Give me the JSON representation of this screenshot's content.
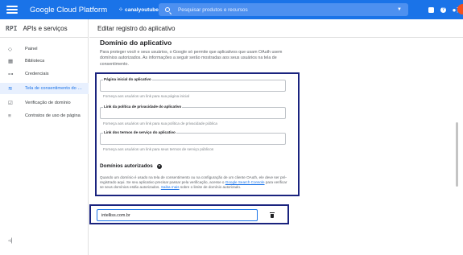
{
  "topbar": {
    "brand": "Google Cloud Platform",
    "project": "canalyoutube",
    "search_placeholder": "Pesquisar produtos e recursos",
    "accent": "#1a73e8"
  },
  "sidebar": {
    "api_badge": "RPI",
    "title": "APIs e serviços",
    "items": [
      {
        "label": "Painel",
        "icon": "dashboard-icon",
        "glyph": "◇"
      },
      {
        "label": "Biblioteca",
        "icon": "library-icon",
        "glyph": "▦"
      },
      {
        "label": "Credenciais",
        "icon": "key-icon",
        "glyph": "⊶"
      },
      {
        "label": "Tela de consentimento do O...",
        "icon": "consent-icon",
        "glyph": "≋"
      },
      {
        "label": "Verificação de domínio",
        "icon": "domain-check-icon",
        "glyph": "☑"
      },
      {
        "label": "Contratos de uso de página",
        "icon": "settings-list-icon",
        "glyph": "≡"
      }
    ],
    "collapse_glyph": "◃|"
  },
  "header": {
    "title": "Editar registro do aplicativo"
  },
  "app_domain": {
    "heading": "Domínio do aplicativo",
    "description": "Para proteger você e seus usuários, o Google só permite que aplicativos que usam OAuth usem domínios autorizados. As informações a seguir serão mostradas aos seus usuários na tela de consentimento.",
    "fields": [
      {
        "label": "Página inicial do aplicativo",
        "value": "",
        "hint": "Forneça aos usuários um link para sua página inicial"
      },
      {
        "label": "Link da política de privacidade do aplicativo",
        "value": "",
        "hint": "Forneça aos usuários um link para sua política de privacidade pública"
      },
      {
        "label": "Link dos termos de serviço do aplicativo",
        "value": "",
        "hint": "Forneça aos usuários um link para seus termos de serviço públicos"
      }
    ]
  },
  "authorized_domains": {
    "heading": "Domínios autorizados",
    "desc_1": "Quando um domínio é usado na tela de consentimento ou na configuração de um cliente OAuth, ele deve ser pré-registrado aqui. Se seu aplicativo precisar passar pela verificação, acesse o ",
    "link_1": "Google Search Console",
    "desc_2": " para verificar se seus domínios estão autorizados. ",
    "link_2": "Saiba mais",
    "desc_3": " sobre o limite de domínio autorizado.",
    "domains": [
      "intelliss.com.br"
    ]
  }
}
